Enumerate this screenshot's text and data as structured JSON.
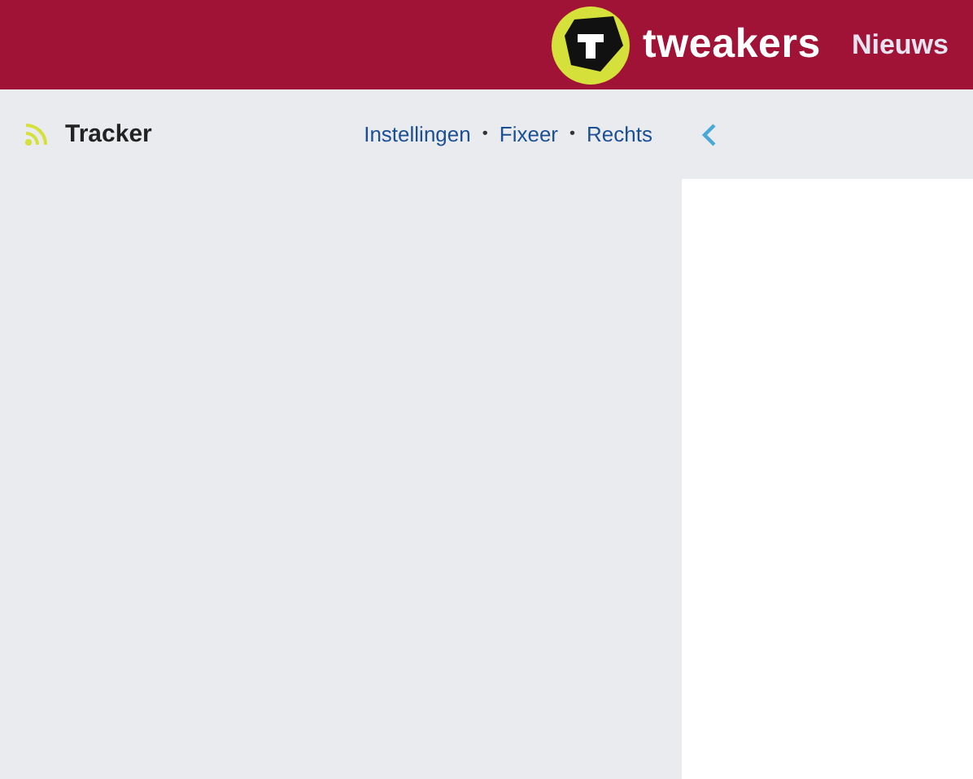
{
  "header": {
    "brand": "tweakers",
    "nav": [
      "Nieuws"
    ]
  },
  "tracker": {
    "title": "Tracker",
    "actions": [
      {
        "kind": "link",
        "text": "Instellingen"
      },
      {
        "kind": "separator",
        "text": "•"
      },
      {
        "kind": "link",
        "text": "Fixeer"
      },
      {
        "kind": "separator",
        "text": "•"
      },
      {
        "kind": "link",
        "text": "Rechts"
      }
    ]
  }
}
